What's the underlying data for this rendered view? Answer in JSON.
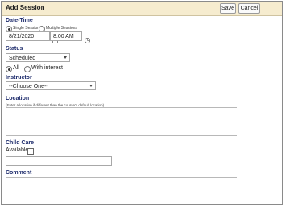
{
  "dialog": {
    "title": "Add Session",
    "save_label": "Save",
    "cancel_label": "Cancel"
  },
  "datetime": {
    "section_label": "Date-Time",
    "single_label": "Single Session",
    "multiple_label": "Multiple Sessions",
    "selected": "single",
    "date_value": "8/21/2020",
    "time_value": "8:00 AM",
    "calendar_icon": "calendar-icon",
    "clock_icon": "clock-icon"
  },
  "status": {
    "section_label": "Status",
    "selected_value": "Scheduled",
    "all_label": "All",
    "interest_label": "With interest",
    "selected_filter": "all"
  },
  "instructor": {
    "section_label": "Instructor",
    "selected_value": "--Choose One--"
  },
  "location": {
    "section_label": "Location",
    "hint": "(Enter a location if different than the course's default location)",
    "value": ""
  },
  "child_care": {
    "section_label": "Child Care",
    "available_label": "Available",
    "available_checked": false,
    "value": ""
  },
  "comment": {
    "section_label": "Comment",
    "value": ""
  },
  "colors": {
    "titlebar": "#f6eccf",
    "section_label": "#1c2a6b",
    "border": "#a8a8a8"
  }
}
